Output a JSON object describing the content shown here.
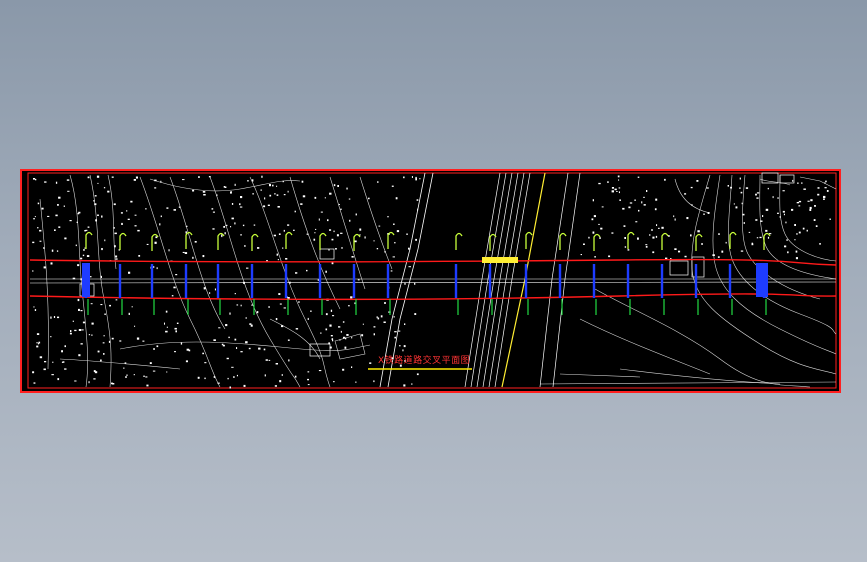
{
  "drawing": {
    "title": "X铁路道路交叉平面图",
    "colors": {
      "background": "#000000",
      "frame": "#ff2020",
      "alignment_lines": "#ff1a1a",
      "piles": "#1e3cff",
      "labels": "#c8ff3a",
      "markers": "#22dd44",
      "title_text": "#ff3333",
      "title_underline": "#ffee00",
      "railway": "#ffee33",
      "terrain": "#ffffff"
    }
  }
}
